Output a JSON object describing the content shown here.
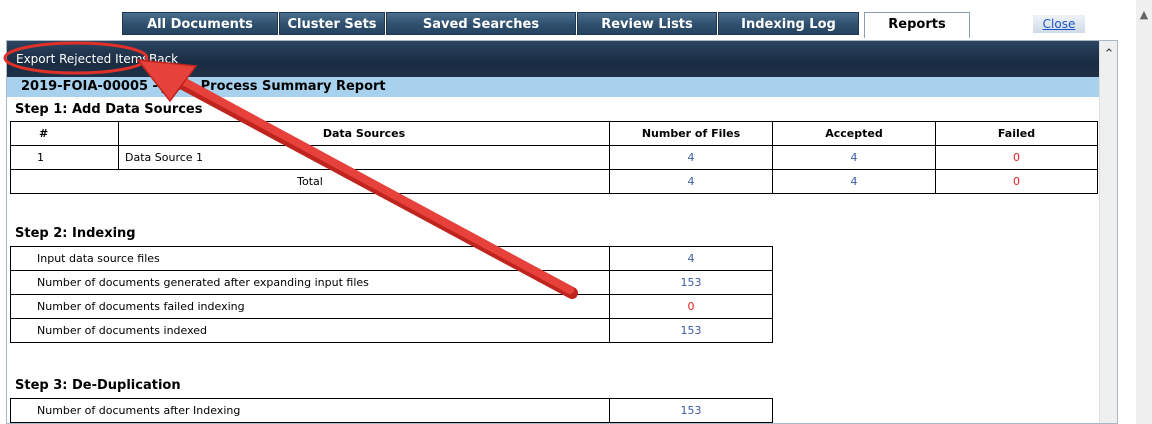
{
  "tabs": [
    {
      "label": "All Documents"
    },
    {
      "label": "Cluster Sets"
    },
    {
      "label": "Saved Searches"
    },
    {
      "label": "Review Lists"
    },
    {
      "label": "Indexing Log"
    },
    {
      "label": "Reports"
    }
  ],
  "close_label": "Close",
  "toolbar": {
    "export_label": "Export Rejected Items",
    "back_label": "Back"
  },
  "report_title": "2019-FOIA-00005 - JER - Process Summary Report",
  "step1": {
    "title": "Step 1: Add Data Sources",
    "headers": [
      "#",
      "Data Sources",
      "Number of Files",
      "Accepted",
      "Failed"
    ],
    "row": {
      "index": "1",
      "source": "Data Source 1",
      "files": "4",
      "accepted": "4",
      "failed": "0"
    },
    "total": {
      "label": "Total",
      "files": "4",
      "accepted": "4",
      "failed": "0"
    }
  },
  "step2": {
    "title": "Step 2: Indexing",
    "rows": [
      {
        "label": "Input data source files",
        "value": "4"
      },
      {
        "label": "Number of documents generated after expanding input files",
        "value": "153"
      },
      {
        "label": "Number of documents failed indexing",
        "value": "0"
      },
      {
        "label": "Number of documents indexed",
        "value": "153"
      }
    ]
  },
  "step3": {
    "title": "Step 3: De-Duplication",
    "rows": [
      {
        "label": "Number of documents after Indexing",
        "value": "153"
      }
    ]
  },
  "colors": {
    "link_blue": "#3b5ba5",
    "fail_red": "#e02020",
    "annotation_red": "#e0302a"
  }
}
